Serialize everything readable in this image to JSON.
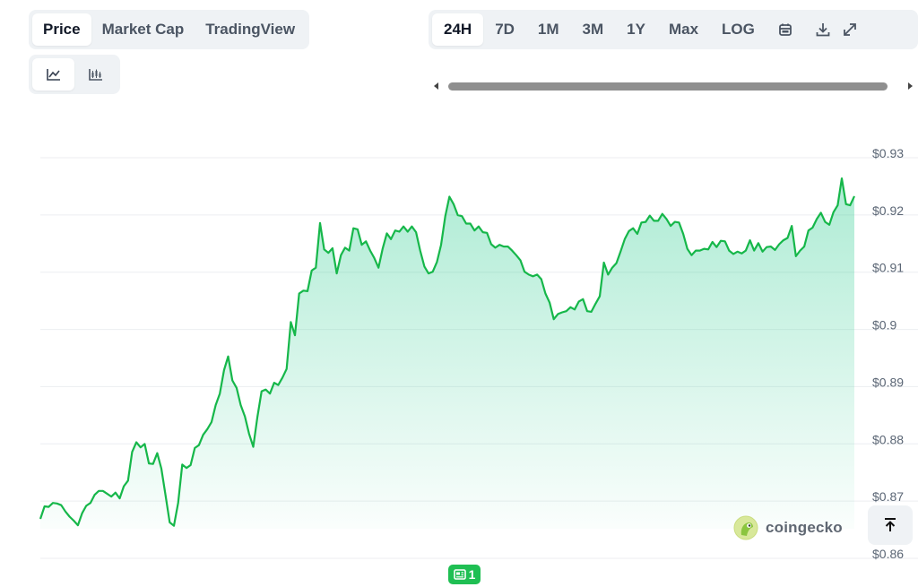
{
  "view_tabs": [
    "Price",
    "Market Cap",
    "TradingView"
  ],
  "view_active": 0,
  "range_tabs": [
    "24H",
    "7D",
    "1M",
    "3M",
    "1Y",
    "Max",
    "LOG"
  ],
  "range_active": 0,
  "range_icons": [
    "calendar-icon",
    "download-icon",
    "expand-icon"
  ],
  "chart_type_icons": [
    "line-chart-icon",
    "candlestick-chart-icon"
  ],
  "chart_type_active": 0,
  "watermark": {
    "brand": "coingecko"
  },
  "news_badge": {
    "count": "1"
  },
  "colors": {
    "line": "#16b74a",
    "fill_top": "#16c784",
    "accent": "#1fbf53"
  },
  "chart_data": {
    "type": "area",
    "title": "",
    "xlabel": "",
    "ylabel": "",
    "ylim": [
      0.86,
      0.93
    ],
    "y_ticks": [
      {
        "value": 0.93,
        "label": "$0.93"
      },
      {
        "value": 0.92,
        "label": "$0.92"
      },
      {
        "value": 0.91,
        "label": "$0.91"
      },
      {
        "value": 0.9,
        "label": "$0.9"
      },
      {
        "value": 0.89,
        "label": "$0.89"
      },
      {
        "value": 0.88,
        "label": "$0.88"
      },
      {
        "value": 0.87,
        "label": "$0.87"
      },
      {
        "value": 0.86,
        "label": "$0.86"
      }
    ],
    "grid": true,
    "series": [
      {
        "values": [
          0.8661,
          0.8683,
          0.8682,
          0.8689,
          0.8688,
          0.8685,
          0.8674,
          0.8665,
          0.8658,
          0.865,
          0.8671,
          0.8684,
          0.8689,
          0.8703,
          0.871,
          0.871,
          0.8705,
          0.87,
          0.8707,
          0.8697,
          0.8718,
          0.8728,
          0.8778,
          0.8795,
          0.8786,
          0.8792,
          0.8758,
          0.8757,
          0.8776,
          0.8749,
          0.8702,
          0.8655,
          0.8649,
          0.8689,
          0.8756,
          0.875,
          0.8755,
          0.8785,
          0.879,
          0.8808,
          0.8818,
          0.883,
          0.886,
          0.888,
          0.8921,
          0.8945,
          0.8903,
          0.889,
          0.886,
          0.884,
          0.881,
          0.8787,
          0.8839,
          0.8884,
          0.8887,
          0.888,
          0.8899,
          0.8895,
          0.8908,
          0.8923,
          0.9005,
          0.8982,
          0.9055,
          0.906,
          0.9059,
          0.9095,
          0.91,
          0.9178,
          0.9132,
          0.9126,
          0.9134,
          0.909,
          0.9122,
          0.9135,
          0.913,
          0.9169,
          0.9167,
          0.914,
          0.9146,
          0.913,
          0.9117,
          0.91,
          0.9133,
          0.916,
          0.915,
          0.9165,
          0.9163,
          0.9172,
          0.9163,
          0.9172,
          0.9162,
          0.913,
          0.9102,
          0.909,
          0.9093,
          0.911,
          0.914,
          0.919,
          0.9224,
          0.9211,
          0.9192,
          0.919,
          0.9177,
          0.9177,
          0.9165,
          0.9172,
          0.9162,
          0.9161,
          0.9141,
          0.9135,
          0.914,
          0.9137,
          0.9137,
          0.913,
          0.9122,
          0.9113,
          0.9093,
          0.9088,
          0.9085,
          0.9088,
          0.908,
          0.9055,
          0.9039,
          0.901,
          0.9019,
          0.9022,
          0.9024,
          0.9031,
          0.9027,
          0.9041,
          0.9045,
          0.9024,
          0.9023,
          0.9037,
          0.905,
          0.9109,
          0.9088,
          0.91,
          0.9108,
          0.9128,
          0.915,
          0.9164,
          0.9169,
          0.9159,
          0.9179,
          0.918,
          0.9191,
          0.9182,
          0.9182,
          0.9194,
          0.9185,
          0.9173,
          0.918,
          0.9179,
          0.9159,
          0.9133,
          0.9122,
          0.913,
          0.913,
          0.9133,
          0.9132,
          0.9145,
          0.9136,
          0.9147,
          0.9146,
          0.913,
          0.9124,
          0.9128,
          0.9125,
          0.913,
          0.9148,
          0.913,
          0.9143,
          0.9128,
          0.9136,
          0.9137,
          0.9131,
          0.9141,
          0.9148,
          0.9152,
          0.9173,
          0.912,
          0.913,
          0.9137,
          0.9165,
          0.917,
          0.9185,
          0.9196,
          0.918,
          0.9175,
          0.9197,
          0.9209,
          0.9256,
          0.9211,
          0.9209,
          0.9225
        ]
      }
    ]
  }
}
